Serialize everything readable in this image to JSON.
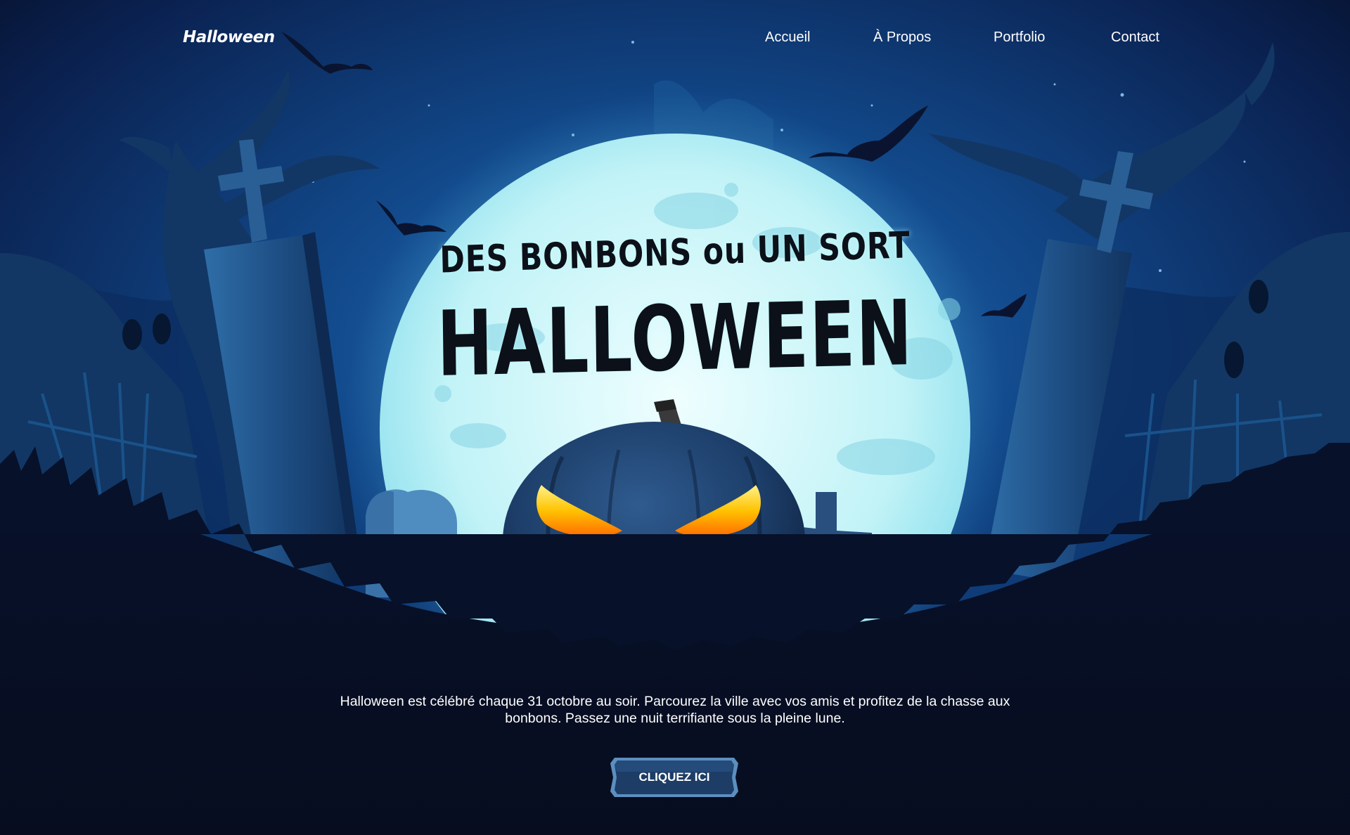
{
  "brand": {
    "logo_text": "Halloween"
  },
  "nav": {
    "items": [
      {
        "label": "Accueil"
      },
      {
        "label": "À Propos"
      },
      {
        "label": "Portfolio"
      },
      {
        "label": "Contact"
      }
    ]
  },
  "hero": {
    "subtitle": "DES BONBONS ou UN SORT",
    "title": "HALLOWEEN",
    "description": "Halloween est célébré chaque 31 octobre au soir. Parcourez la ville avec vos amis et profitez de la chasse aux bonbons. Passez une nuit terrifiante sous la pleine lune.",
    "cta_label": "CLIQUEZ ICI"
  },
  "colors": {
    "background": "#070d1f",
    "sky": "#0d3f7c",
    "moon": "#c8f6f8",
    "pumpkin": "#1e3d66",
    "glow": "#ffb000",
    "button": "#1d3d66"
  }
}
